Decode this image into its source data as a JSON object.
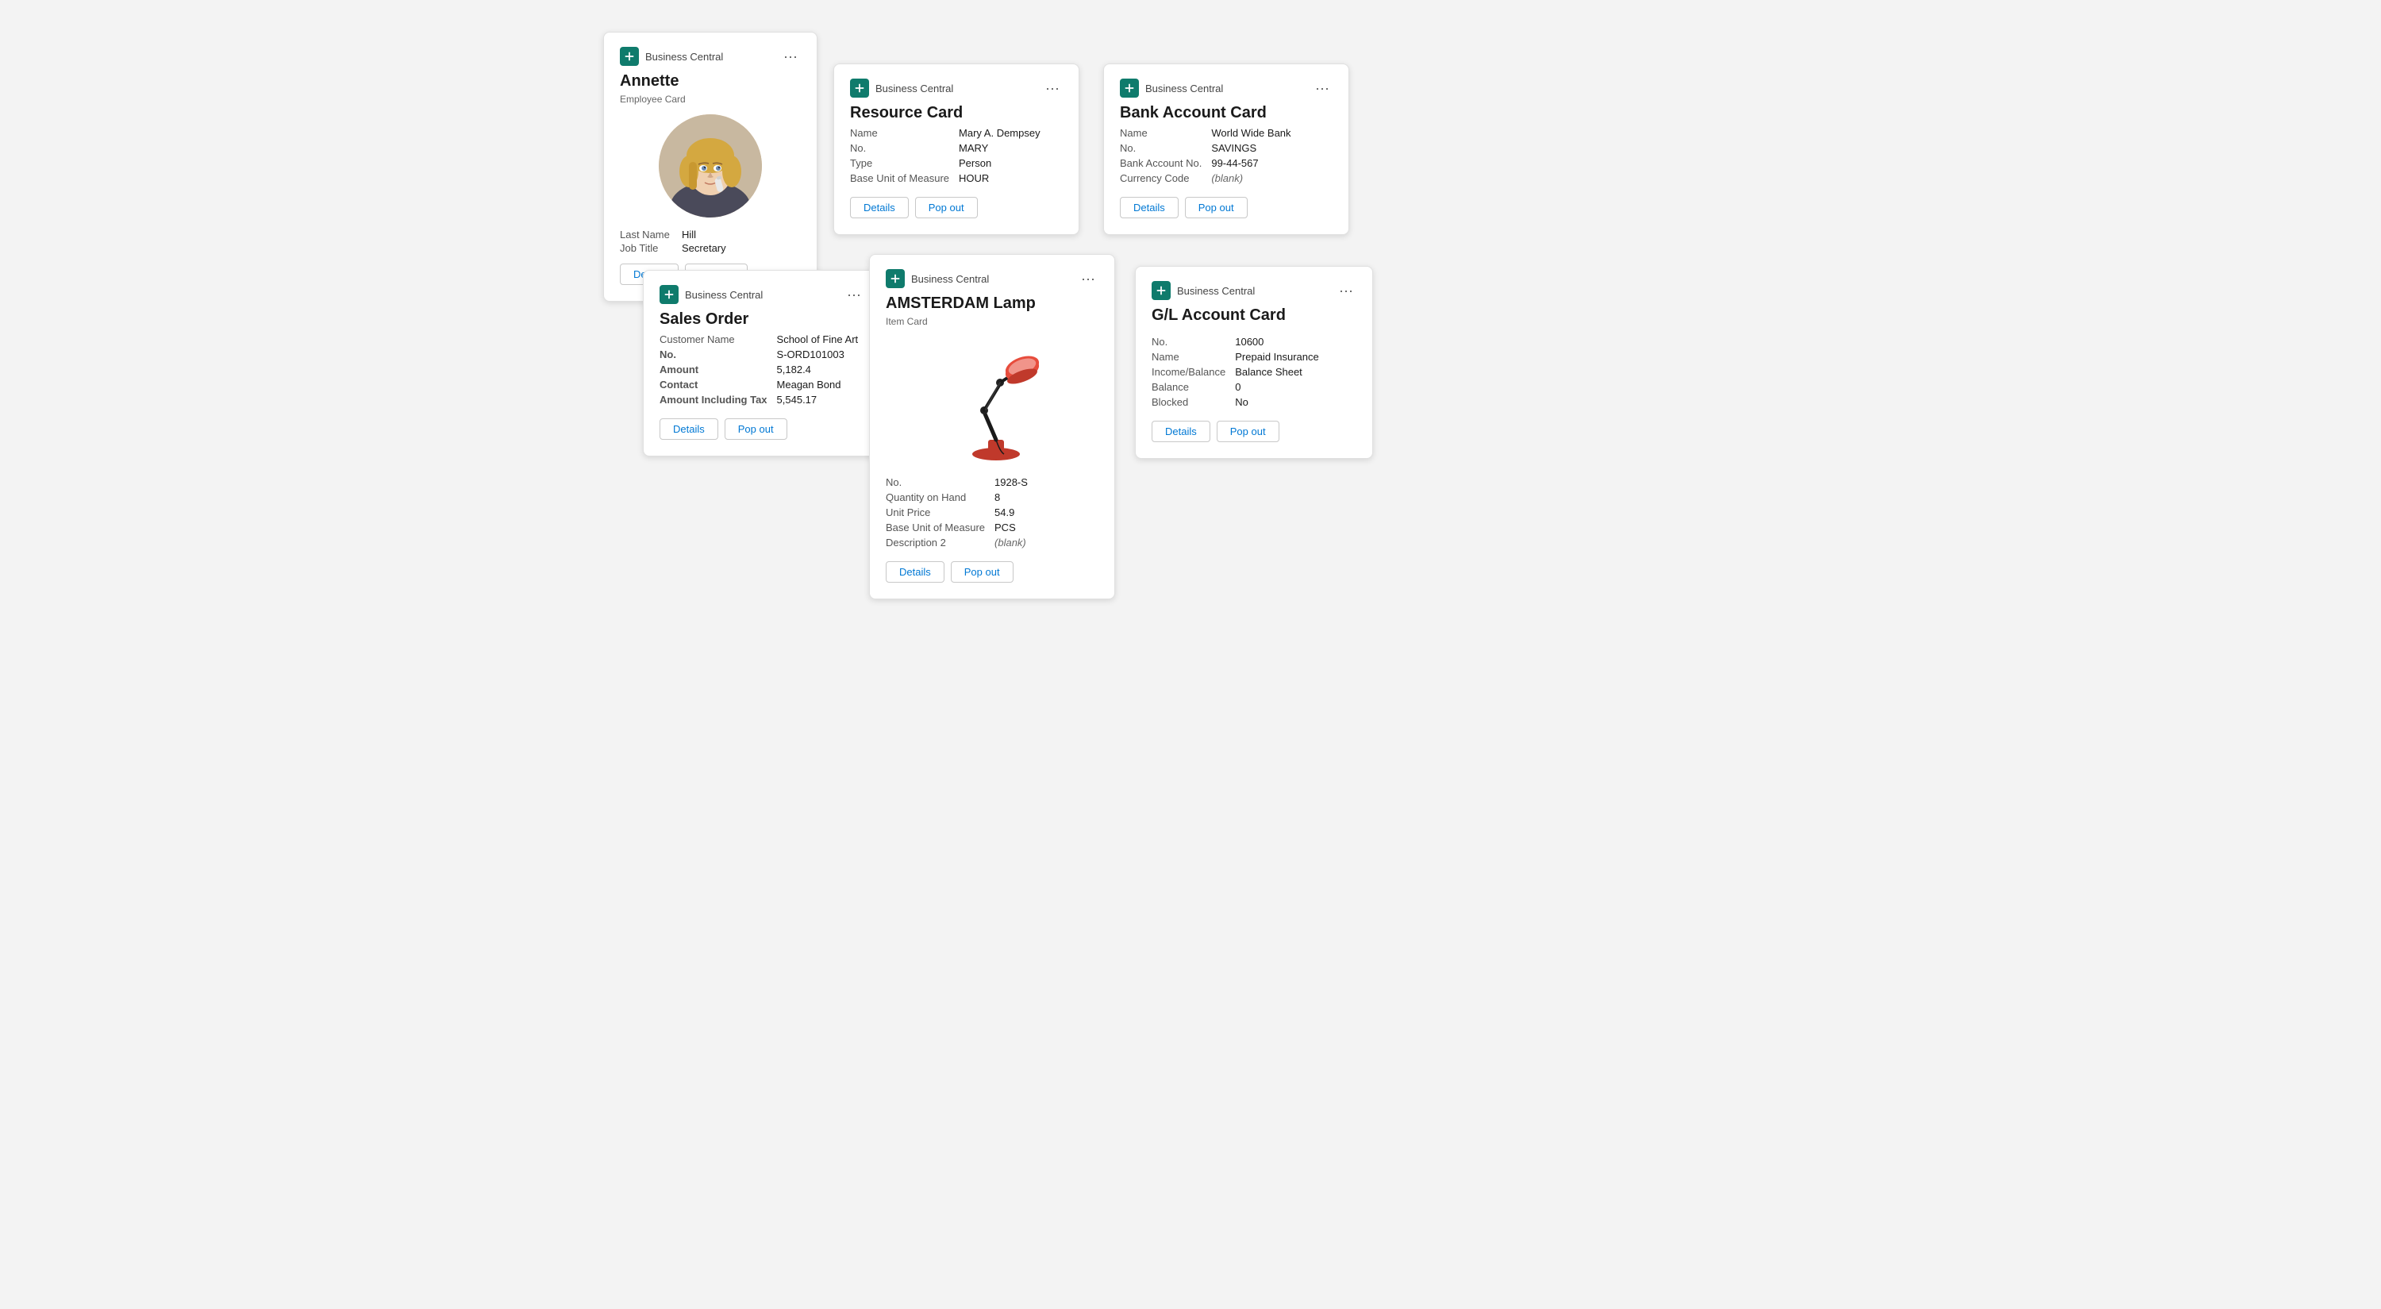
{
  "app_name": "Business Central",
  "cards": {
    "employee": {
      "title": "Annette",
      "subtitle": "Employee Card",
      "fields": [
        {
          "label": "Last Name",
          "value": "Hill"
        },
        {
          "label": "Job Title",
          "value": "Secretary"
        }
      ],
      "actions": {
        "details": "Details",
        "popout": "Pop out"
      }
    },
    "resource": {
      "title": "Resource Card",
      "fields": [
        {
          "label": "Name",
          "value": "Mary A. Dempsey"
        },
        {
          "label": "No.",
          "value": "MARY"
        },
        {
          "label": "Type",
          "value": "Person"
        },
        {
          "label": "Base Unit of Measure",
          "value": "HOUR"
        }
      ],
      "actions": {
        "details": "Details",
        "popout": "Pop out"
      }
    },
    "bank": {
      "title": "Bank Account Card",
      "fields": [
        {
          "label": "Name",
          "value": "World Wide Bank"
        },
        {
          "label": "No.",
          "value": "SAVINGS"
        },
        {
          "label": "Bank Account No.",
          "value": "99-44-567"
        },
        {
          "label": "Currency Code",
          "value": "(blank)"
        }
      ],
      "actions": {
        "details": "Details",
        "popout": "Pop out"
      }
    },
    "sales": {
      "title": "Sales Order",
      "fields": [
        {
          "label": "Customer Name",
          "value": "School of Fine Art"
        },
        {
          "label": "No.",
          "value": "S-ORD101003"
        },
        {
          "label": "Amount",
          "value": "5,182.4"
        },
        {
          "label": "Contact",
          "value": "Meagan Bond"
        },
        {
          "label": "Amount Including Tax",
          "value": "5,545.17"
        }
      ],
      "actions": {
        "details": "Details",
        "popout": "Pop out"
      }
    },
    "lamp": {
      "title": "AMSTERDAM Lamp",
      "subtitle": "Item Card",
      "fields": [
        {
          "label": "No.",
          "value": "1928-S"
        },
        {
          "label": "Quantity on Hand",
          "value": "8"
        },
        {
          "label": "Unit Price",
          "value": "54.9"
        },
        {
          "label": "Base Unit of Measure",
          "value": "PCS"
        },
        {
          "label": "Description 2",
          "value": "(blank)"
        }
      ],
      "actions": {
        "details": "Details",
        "popout": "Pop out"
      }
    },
    "gl": {
      "title": "G/L Account Card",
      "fields": [
        {
          "label": "No.",
          "value": "10600"
        },
        {
          "label": "Name",
          "value": "Prepaid Insurance"
        },
        {
          "label": "Income/Balance",
          "value": "Balance Sheet"
        },
        {
          "label": "Balance",
          "value": "0"
        },
        {
          "label": "Blocked",
          "value": "No"
        }
      ],
      "actions": {
        "details": "Details",
        "popout": "Pop out"
      }
    }
  },
  "icons": {
    "bc_plus": "plus-icon",
    "more": "more-options-icon"
  },
  "colors": {
    "bc_green": "#0f7b6c",
    "link_blue": "#0078d4"
  }
}
